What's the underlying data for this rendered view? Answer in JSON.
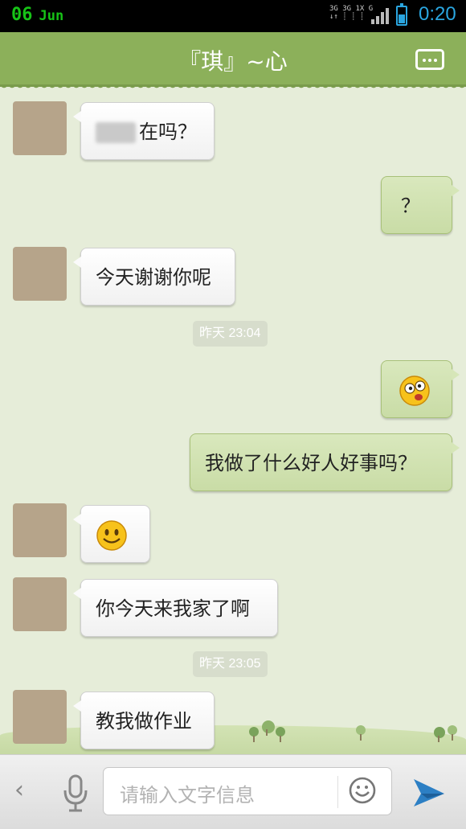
{
  "status_bar": {
    "date_day": "06",
    "date_month": "Jun",
    "network_top": "3G 3G 1X  G",
    "network_bottom": "↓↑ ┊  ┊  ┊",
    "time": "0:20",
    "battery_level": 0.6
  },
  "header": {
    "title": "『琪』~心",
    "menu_icon": "more-options-icon"
  },
  "messages": [
    {
      "side": "in",
      "text": "在吗？",
      "has_blurred_name": true
    },
    {
      "side": "out",
      "text": "？"
    },
    {
      "side": "in",
      "text": "今天谢谢你呢"
    },
    {
      "side": "timestamp",
      "text": "昨天 23:04"
    },
    {
      "side": "out",
      "emoji": "dizzy-face-emoji"
    },
    {
      "side": "out",
      "text": "我做了什么好人好事吗？"
    },
    {
      "side": "in",
      "emoji": "smiley-emoji"
    },
    {
      "side": "in",
      "text": "你今天来我家了啊"
    },
    {
      "side": "timestamp",
      "text": "昨天 23:05"
    },
    {
      "side": "in",
      "text": "教我做作业"
    }
  ],
  "input_bar": {
    "back_icon": "chevron-left-icon",
    "voice_icon": "microphone-icon",
    "placeholder": "请输入文字信息",
    "emoji_icon": "smiley-icon",
    "send_icon": "send-icon"
  },
  "colors": {
    "header": "#8cb05a",
    "background": "#e6edd9",
    "outgoing_bubble": "#d2e3b2",
    "incoming_bubble": "#ffffff",
    "accent": "#2aa6e0"
  }
}
